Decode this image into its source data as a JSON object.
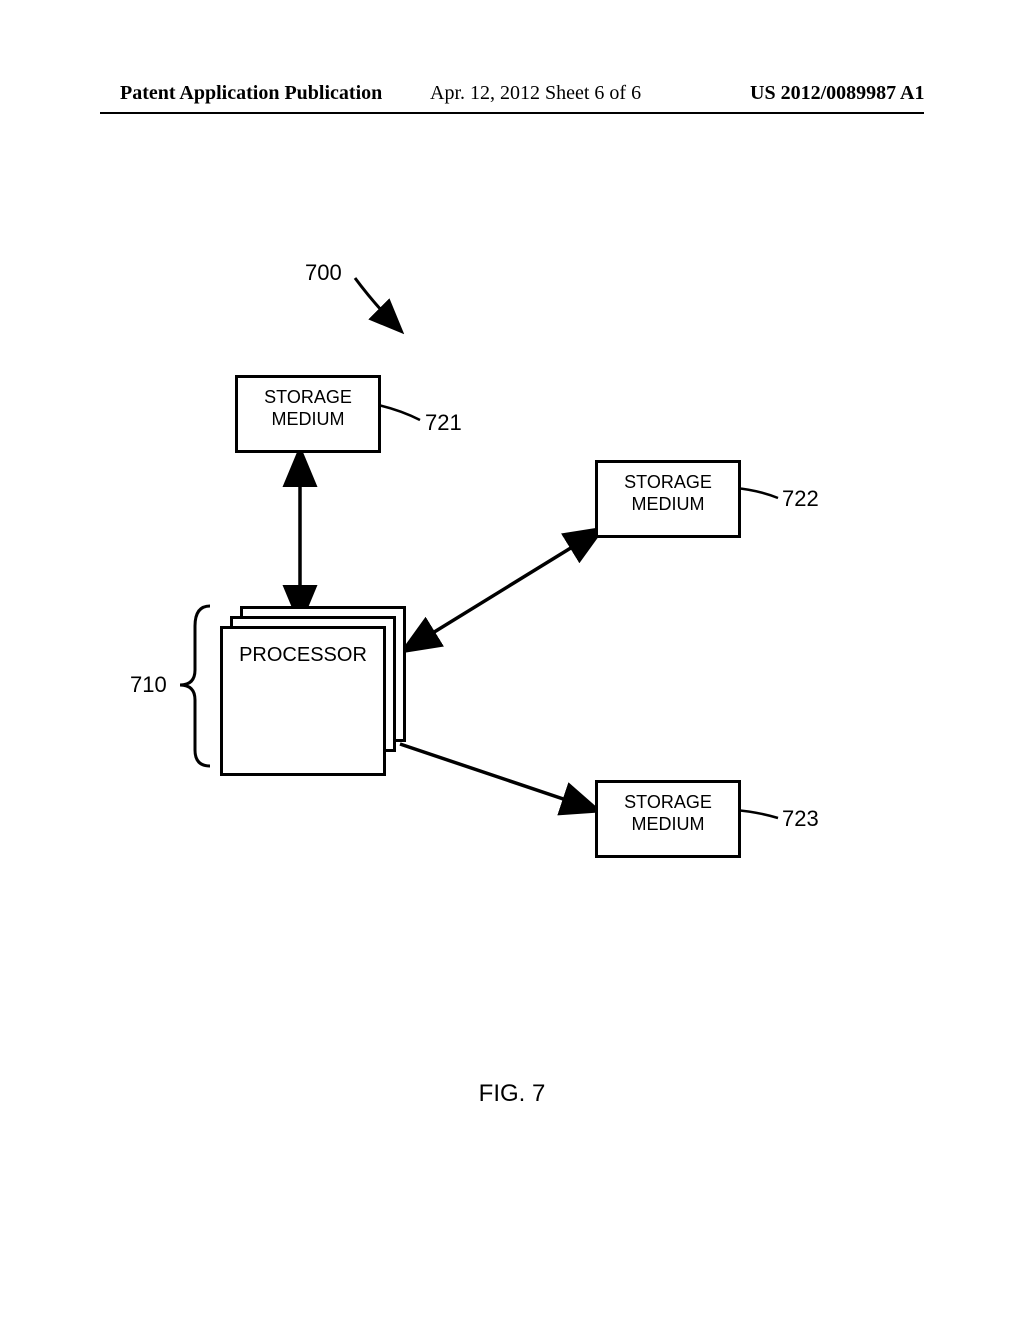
{
  "header": {
    "left": "Patent Application Publication",
    "mid": "Apr. 12, 2012  Sheet 6 of 6",
    "right": "US 2012/0089987 A1"
  },
  "diagram": {
    "reference_700": "700",
    "reference_710": "710",
    "reference_721": "721",
    "reference_722": "722",
    "reference_723": "723",
    "storage_label": "STORAGE\nMEDIUM",
    "processor_label": "PROCESSOR"
  },
  "figure_label": "FIG. 7"
}
